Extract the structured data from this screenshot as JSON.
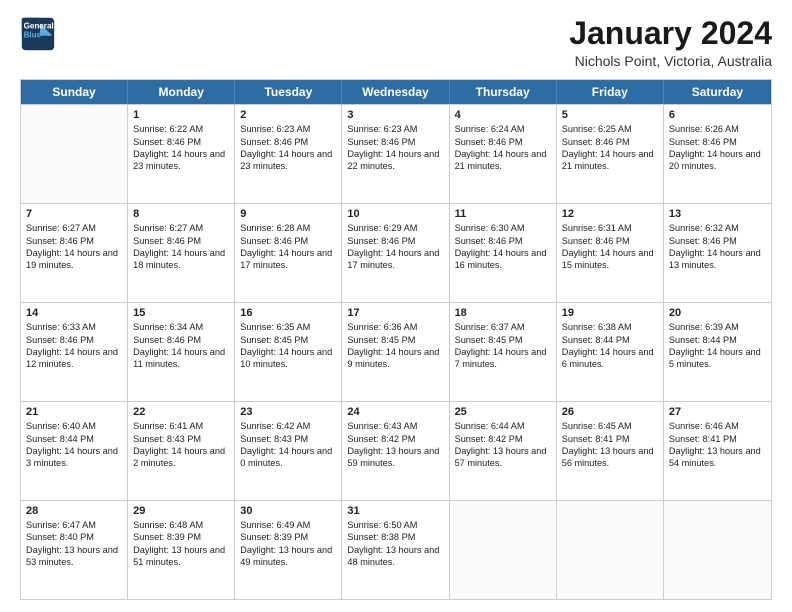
{
  "logo": {
    "line1": "General",
    "line2": "Blue"
  },
  "title": "January 2024",
  "subtitle": "Nichols Point, Victoria, Australia",
  "header_days": [
    "Sunday",
    "Monday",
    "Tuesday",
    "Wednesday",
    "Thursday",
    "Friday",
    "Saturday"
  ],
  "weeks": [
    [
      {
        "day": "",
        "empty": true
      },
      {
        "day": "1",
        "rise": "6:22 AM",
        "set": "8:46 PM",
        "daylight": "14 hours and 23 minutes."
      },
      {
        "day": "2",
        "rise": "6:23 AM",
        "set": "8:46 PM",
        "daylight": "14 hours and 23 minutes."
      },
      {
        "day": "3",
        "rise": "6:23 AM",
        "set": "8:46 PM",
        "daylight": "14 hours and 22 minutes."
      },
      {
        "day": "4",
        "rise": "6:24 AM",
        "set": "8:46 PM",
        "daylight": "14 hours and 21 minutes."
      },
      {
        "day": "5",
        "rise": "6:25 AM",
        "set": "8:46 PM",
        "daylight": "14 hours and 21 minutes."
      },
      {
        "day": "6",
        "rise": "6:26 AM",
        "set": "8:46 PM",
        "daylight": "14 hours and 20 minutes."
      }
    ],
    [
      {
        "day": "7",
        "rise": "6:27 AM",
        "set": "8:46 PM",
        "daylight": "14 hours and 19 minutes."
      },
      {
        "day": "8",
        "rise": "6:27 AM",
        "set": "8:46 PM",
        "daylight": "14 hours and 18 minutes."
      },
      {
        "day": "9",
        "rise": "6:28 AM",
        "set": "8:46 PM",
        "daylight": "14 hours and 17 minutes."
      },
      {
        "day": "10",
        "rise": "6:29 AM",
        "set": "8:46 PM",
        "daylight": "14 hours and 17 minutes."
      },
      {
        "day": "11",
        "rise": "6:30 AM",
        "set": "8:46 PM",
        "daylight": "14 hours and 16 minutes."
      },
      {
        "day": "12",
        "rise": "6:31 AM",
        "set": "8:46 PM",
        "daylight": "14 hours and 15 minutes."
      },
      {
        "day": "13",
        "rise": "6:32 AM",
        "set": "8:46 PM",
        "daylight": "14 hours and 13 minutes."
      }
    ],
    [
      {
        "day": "14",
        "rise": "6:33 AM",
        "set": "8:46 PM",
        "daylight": "14 hours and 12 minutes."
      },
      {
        "day": "15",
        "rise": "6:34 AM",
        "set": "8:46 PM",
        "daylight": "14 hours and 11 minutes."
      },
      {
        "day": "16",
        "rise": "6:35 AM",
        "set": "8:45 PM",
        "daylight": "14 hours and 10 minutes."
      },
      {
        "day": "17",
        "rise": "6:36 AM",
        "set": "8:45 PM",
        "daylight": "14 hours and 9 minutes."
      },
      {
        "day": "18",
        "rise": "6:37 AM",
        "set": "8:45 PM",
        "daylight": "14 hours and 7 minutes."
      },
      {
        "day": "19",
        "rise": "6:38 AM",
        "set": "8:44 PM",
        "daylight": "14 hours and 6 minutes."
      },
      {
        "day": "20",
        "rise": "6:39 AM",
        "set": "8:44 PM",
        "daylight": "14 hours and 5 minutes."
      }
    ],
    [
      {
        "day": "21",
        "rise": "6:40 AM",
        "set": "8:44 PM",
        "daylight": "14 hours and 3 minutes."
      },
      {
        "day": "22",
        "rise": "6:41 AM",
        "set": "8:43 PM",
        "daylight": "14 hours and 2 minutes."
      },
      {
        "day": "23",
        "rise": "6:42 AM",
        "set": "8:43 PM",
        "daylight": "14 hours and 0 minutes."
      },
      {
        "day": "24",
        "rise": "6:43 AM",
        "set": "8:42 PM",
        "daylight": "13 hours and 59 minutes."
      },
      {
        "day": "25",
        "rise": "6:44 AM",
        "set": "8:42 PM",
        "daylight": "13 hours and 57 minutes."
      },
      {
        "day": "26",
        "rise": "6:45 AM",
        "set": "8:41 PM",
        "daylight": "13 hours and 56 minutes."
      },
      {
        "day": "27",
        "rise": "6:46 AM",
        "set": "8:41 PM",
        "daylight": "13 hours and 54 minutes."
      }
    ],
    [
      {
        "day": "28",
        "rise": "6:47 AM",
        "set": "8:40 PM",
        "daylight": "13 hours and 53 minutes."
      },
      {
        "day": "29",
        "rise": "6:48 AM",
        "set": "8:39 PM",
        "daylight": "13 hours and 51 minutes."
      },
      {
        "day": "30",
        "rise": "6:49 AM",
        "set": "8:39 PM",
        "daylight": "13 hours and 49 minutes."
      },
      {
        "day": "31",
        "rise": "6:50 AM",
        "set": "8:38 PM",
        "daylight": "13 hours and 48 minutes."
      },
      {
        "day": "",
        "empty": true
      },
      {
        "day": "",
        "empty": true
      },
      {
        "day": "",
        "empty": true
      }
    ]
  ]
}
